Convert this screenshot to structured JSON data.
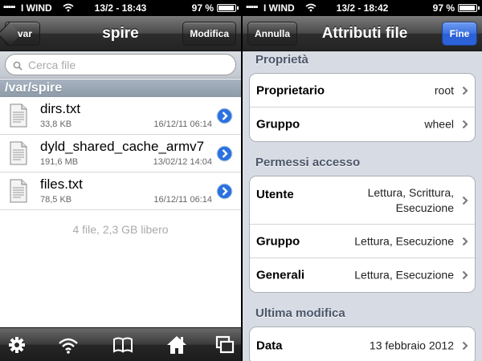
{
  "left": {
    "status": {
      "carrier": "I WIND",
      "time": "13/2 - 18:43",
      "battery": "97 %",
      "battery_level": 0.97
    },
    "nav": {
      "back_label": "var",
      "title": "spire",
      "edit_label": "Modifica"
    },
    "search": {
      "placeholder": "Cerca file",
      "value": ""
    },
    "path": "/var/spire",
    "files": [
      {
        "name": "dirs.txt",
        "size": "33,8 KB",
        "date": "16/12/11 06:14"
      },
      {
        "name": "dyld_shared_cache_armv7",
        "size": "191,6 MB",
        "date": "13/02/12 14:04"
      },
      {
        "name": "files.txt",
        "size": "78,5 KB",
        "date": "16/12/11 06:14"
      }
    ],
    "summary": "4 file, 2,3 GB libero",
    "toolbar": [
      "gear-icon",
      "wifi-icon",
      "book-icon",
      "home-icon",
      "windows-icon"
    ]
  },
  "right": {
    "status": {
      "carrier": "I WIND",
      "time": "13/2 - 18:42",
      "battery": "97 %",
      "battery_level": 0.97
    },
    "nav": {
      "cancel_label": "Annulla",
      "title": "Attributi file",
      "done_label": "Fine"
    },
    "sections": [
      {
        "title": "Proprietà",
        "rows": [
          {
            "label": "Proprietario",
            "value": "root"
          },
          {
            "label": "Gruppo",
            "value": "wheel"
          }
        ]
      },
      {
        "title": "Permessi accesso",
        "rows": [
          {
            "label": "Utente",
            "value": "Lettura, Scrittura, Esecuzione"
          },
          {
            "label": "Gruppo",
            "value": "Lettura, Esecuzione"
          },
          {
            "label": "Generali",
            "value": "Lettura, Esecuzione"
          }
        ]
      },
      {
        "title": "Ultima modifica",
        "rows": [
          {
            "label": "Data",
            "value": "13 febbraio 2012"
          }
        ]
      }
    ]
  },
  "colors": {
    "accent_blue": "#2d63d9",
    "nav_dark": "#2e2e2e",
    "group_bg": "#d7dbe3",
    "section_text": "#4b566a"
  }
}
